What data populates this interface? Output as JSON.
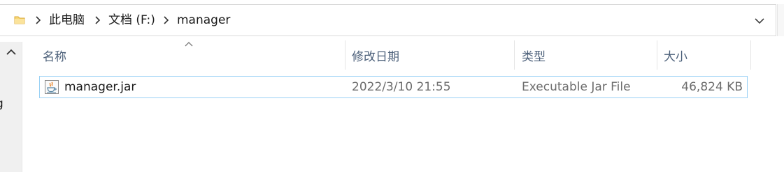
{
  "address_bar": {
    "breadcrumbs": [
      "此电脑",
      "文档 (F:)",
      "manager"
    ],
    "folder_icon": "folder-icon",
    "separator_icon": "chevron-right-icon",
    "dropdown_icon": "chevron-down-icon"
  },
  "nav_pane": {
    "scroll_up_icon": "chevron-up-icon",
    "partial_item_text": "g"
  },
  "columns": {
    "name": "名称",
    "date_modified": "修改日期",
    "type": "类型",
    "size": "大小",
    "sorted_by": "name",
    "sort_direction": "ascending"
  },
  "files": [
    {
      "name": "manager.jar",
      "date_modified": "2022/3/10 21:55",
      "type": "Executable Jar File",
      "size": "46,824 KB",
      "icon": "java-jar-icon"
    }
  ],
  "colors": {
    "header_text": "#4c607a",
    "row_border": "#99d1f5",
    "folder_yellow": "#f8d775"
  }
}
